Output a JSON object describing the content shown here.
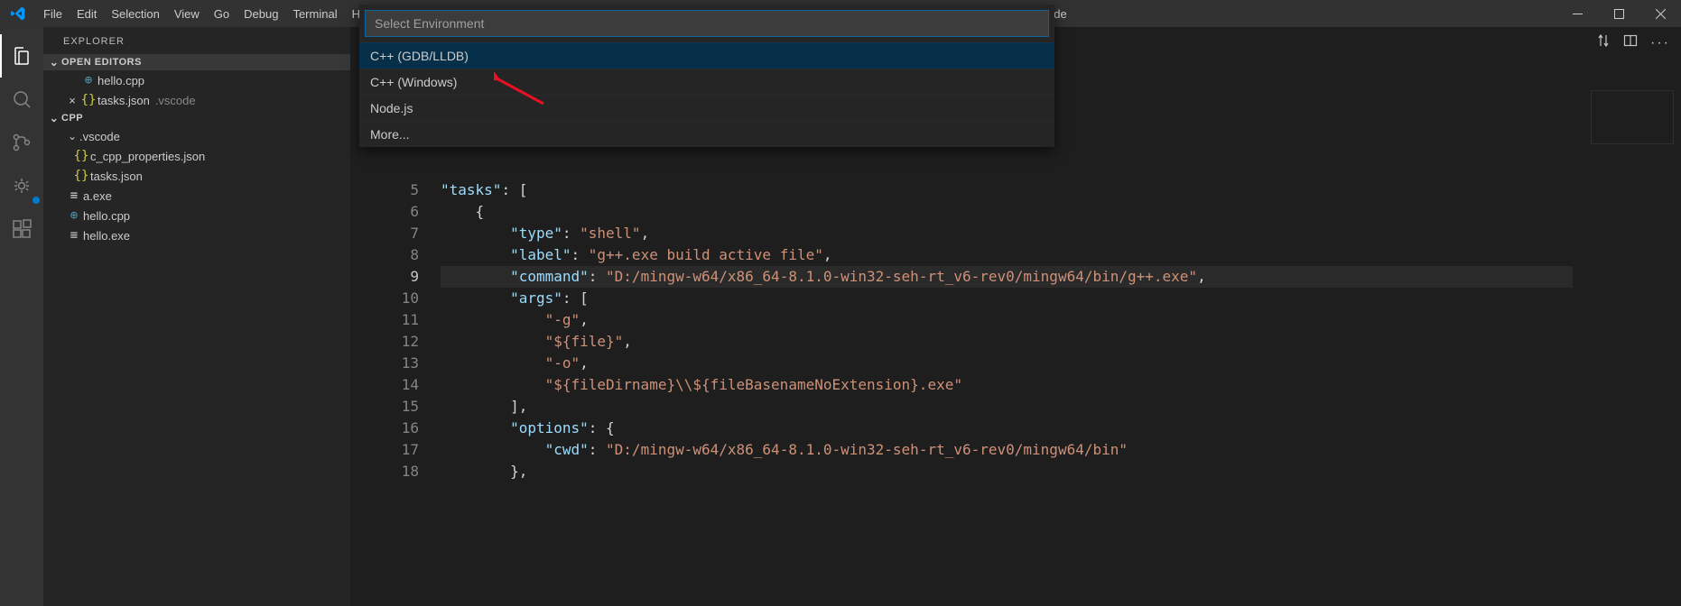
{
  "titlebar": {
    "title": "tasks.json - Cpp - Visual Studio Code",
    "menus": [
      "File",
      "Edit",
      "Selection",
      "View",
      "Go",
      "Debug",
      "Terminal",
      "Help"
    ]
  },
  "sidebar": {
    "title": "EXPLORER",
    "openEditors": {
      "label": "OPEN EDITORS",
      "items": [
        {
          "icon": "cpp",
          "name": "hello.cpp",
          "dirty": false,
          "closeX": false
        },
        {
          "icon": "json",
          "name": "tasks.json",
          "detail": ".vscode",
          "dirty": false,
          "closeX": true
        }
      ]
    },
    "workspace": {
      "label": "CPP",
      "tree": [
        {
          "type": "folder",
          "name": ".vscode",
          "depth": 0,
          "open": true
        },
        {
          "type": "file",
          "icon": "json",
          "name": "c_cpp_properties.json",
          "depth": 1
        },
        {
          "type": "file",
          "icon": "json",
          "name": "tasks.json",
          "depth": 1
        },
        {
          "type": "file",
          "icon": "exe",
          "name": "a.exe",
          "depth": 0
        },
        {
          "type": "file",
          "icon": "cpp",
          "name": "hello.cpp",
          "depth": 0
        },
        {
          "type": "file",
          "icon": "exe",
          "name": "hello.exe",
          "depth": 0
        }
      ]
    }
  },
  "quickInput": {
    "placeholder": "Select Environment",
    "items": [
      "C++ (GDB/LLDB)",
      "C++ (Windows)",
      "Node.js",
      "More..."
    ],
    "selectedIndex": 0
  },
  "editor": {
    "currentLine": 9,
    "lines": [
      {
        "n": 5,
        "tokens": [
          [
            "key",
            "\"tasks\""
          ],
          [
            "punc",
            ": ["
          ]
        ]
      },
      {
        "n": 6,
        "tokens": [
          [
            "punc",
            "    {"
          ]
        ]
      },
      {
        "n": 7,
        "tokens": [
          [
            "punc",
            "        "
          ],
          [
            "key",
            "\"type\""
          ],
          [
            "punc",
            ": "
          ],
          [
            "str",
            "\"shell\""
          ],
          [
            "punc",
            ","
          ]
        ]
      },
      {
        "n": 8,
        "tokens": [
          [
            "punc",
            "        "
          ],
          [
            "key",
            "\"label\""
          ],
          [
            "punc",
            ": "
          ],
          [
            "str",
            "\"g++.exe build active file\""
          ],
          [
            "punc",
            ","
          ]
        ]
      },
      {
        "n": 9,
        "tokens": [
          [
            "punc",
            "        "
          ],
          [
            "key",
            "\"command\""
          ],
          [
            "punc",
            ": "
          ],
          [
            "str",
            "\"D:/mingw-w64/x86_64-8.1.0-win32-seh-rt_v6-rev0/mingw64/bin/g++.exe\""
          ],
          [
            "punc",
            ","
          ]
        ]
      },
      {
        "n": 10,
        "tokens": [
          [
            "punc",
            "        "
          ],
          [
            "key",
            "\"args\""
          ],
          [
            "punc",
            ": ["
          ]
        ]
      },
      {
        "n": 11,
        "tokens": [
          [
            "punc",
            "            "
          ],
          [
            "str",
            "\"-g\""
          ],
          [
            "punc",
            ","
          ]
        ]
      },
      {
        "n": 12,
        "tokens": [
          [
            "punc",
            "            "
          ],
          [
            "str",
            "\"${file}\""
          ],
          [
            "punc",
            ","
          ]
        ]
      },
      {
        "n": 13,
        "tokens": [
          [
            "punc",
            "            "
          ],
          [
            "str",
            "\"-o\""
          ],
          [
            "punc",
            ","
          ]
        ]
      },
      {
        "n": 14,
        "tokens": [
          [
            "punc",
            "            "
          ],
          [
            "str",
            "\"${fileDirname}\\\\${fileBasenameNoExtension}.exe\""
          ]
        ]
      },
      {
        "n": 15,
        "tokens": [
          [
            "punc",
            "        ],"
          ]
        ]
      },
      {
        "n": 16,
        "tokens": [
          [
            "punc",
            "        "
          ],
          [
            "key",
            "\"options\""
          ],
          [
            "punc",
            ": {"
          ]
        ]
      },
      {
        "n": 17,
        "tokens": [
          [
            "punc",
            "            "
          ],
          [
            "key",
            "\"cwd\""
          ],
          [
            "punc",
            ": "
          ],
          [
            "str",
            "\"D:/mingw-w64/x86_64-8.1.0-win32-seh-rt_v6-rev0/mingw64/bin\""
          ]
        ]
      },
      {
        "n": 18,
        "tokens": [
          [
            "punc",
            "        },"
          ]
        ]
      }
    ]
  }
}
